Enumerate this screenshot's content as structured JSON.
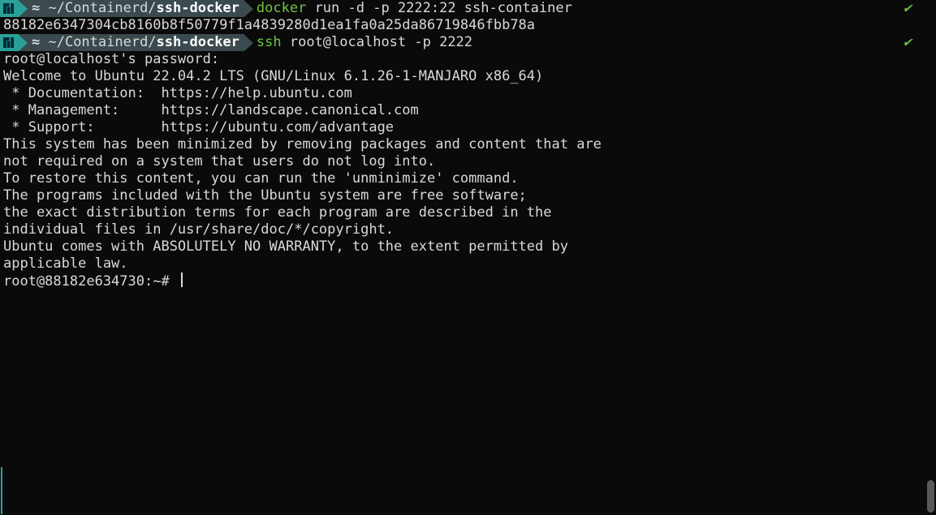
{
  "prompt": {
    "icon_name": "manjaro-icon",
    "path_prefix": "~/Containerd/",
    "path_bold": "ssh-docker"
  },
  "line1": {
    "command_first": "docker",
    "command_rest": " run -d -p 2222:22 ssh-container"
  },
  "line1_output": "88182e6347304cb8160b8f50779f1a4839280d1ea1fa0a25da86719846fbb78a",
  "line2": {
    "command_first": "ssh",
    "command_rest": " root@localhost -p 2222"
  },
  "ssh_output": {
    "l0": "root@localhost's password:",
    "l1": "Welcome to Ubuntu 22.04.2 LTS (GNU/Linux 6.1.26-1-MANJARO x86_64)",
    "l2": "",
    "l3": " * Documentation:  https://help.ubuntu.com",
    "l4": " * Management:     https://landscape.canonical.com",
    "l5": " * Support:        https://ubuntu.com/advantage",
    "l6": "",
    "l7": "This system has been minimized by removing packages and content that are",
    "l8": "not required on a system that users do not log into.",
    "l9": "",
    "l10": "To restore this content, you can run the 'unminimize' command.",
    "l11": "",
    "l12": "The programs included with the Ubuntu system are free software;",
    "l13": "the exact distribution terms for each program are described in the",
    "l14": "individual files in /usr/share/doc/*/copyright.",
    "l15": "",
    "l16": "Ubuntu comes with ABSOLUTELY NO WARRANTY, to the extent permitted by",
    "l17": "applicable law.",
    "l18": ""
  },
  "remote_prompt": "root@88182e634730:~# ",
  "checkmark": "✔"
}
